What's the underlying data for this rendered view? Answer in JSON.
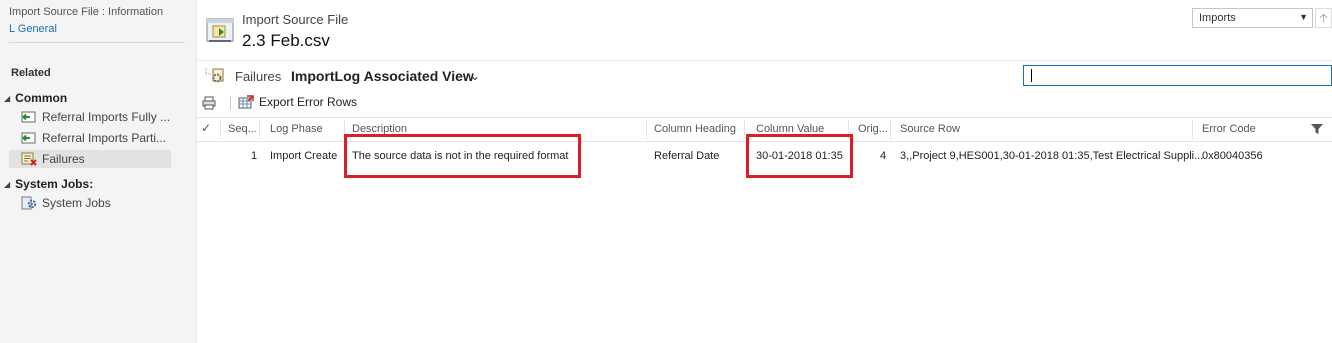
{
  "nav": {
    "entity_info": "Import Source File : Information",
    "general_link": "L General",
    "related_label": "Related",
    "groups": [
      {
        "label": "Common",
        "items": [
          {
            "label": "Referral Imports Fully ...",
            "icon": "import-icon"
          },
          {
            "label": "Referral Imports Parti...",
            "icon": "import-icon"
          },
          {
            "label": "Failures",
            "icon": "failures-icon",
            "selected": true
          }
        ]
      },
      {
        "label": "System Jobs:",
        "items": [
          {
            "label": "System Jobs",
            "icon": "gear-icon"
          }
        ]
      }
    ]
  },
  "header": {
    "entity_name": "Import Source File",
    "record_name": "2.3 Feb.csv",
    "icon": "import-file-icon",
    "form_selector": "Imports",
    "nav_up_icon": "up-arrow-icon"
  },
  "view": {
    "entity": "Failures",
    "name": "ImportLog Associated View",
    "chevron_icon": "chevron-down-icon",
    "search_value": ""
  },
  "commands": {
    "print_icon": "print-icon",
    "export_label": "Export Error Rows",
    "export_icon": "export-icon"
  },
  "grid": {
    "columns": [
      "Seq...",
      "Log Phase",
      "Description",
      "Column Heading",
      "Column Value",
      "Orig...",
      "Source Row",
      "Error Code"
    ],
    "rows": [
      {
        "seq": "1",
        "log_phase": "Import Create",
        "description": "The source data is not in the required format",
        "column_heading": "Referral Date",
        "column_value": "30-01-2018 01:35",
        "orig": "4",
        "source_row": "3,,Project 9,HES001,30-01-2018 01:35,Test Electrical Suppli...",
        "error_code": "0x80040356"
      }
    ]
  },
  "colors": {
    "accent": "#1f6fb5",
    "highlight_box": "#d8202a",
    "nav_background": "#f4f4f4"
  }
}
